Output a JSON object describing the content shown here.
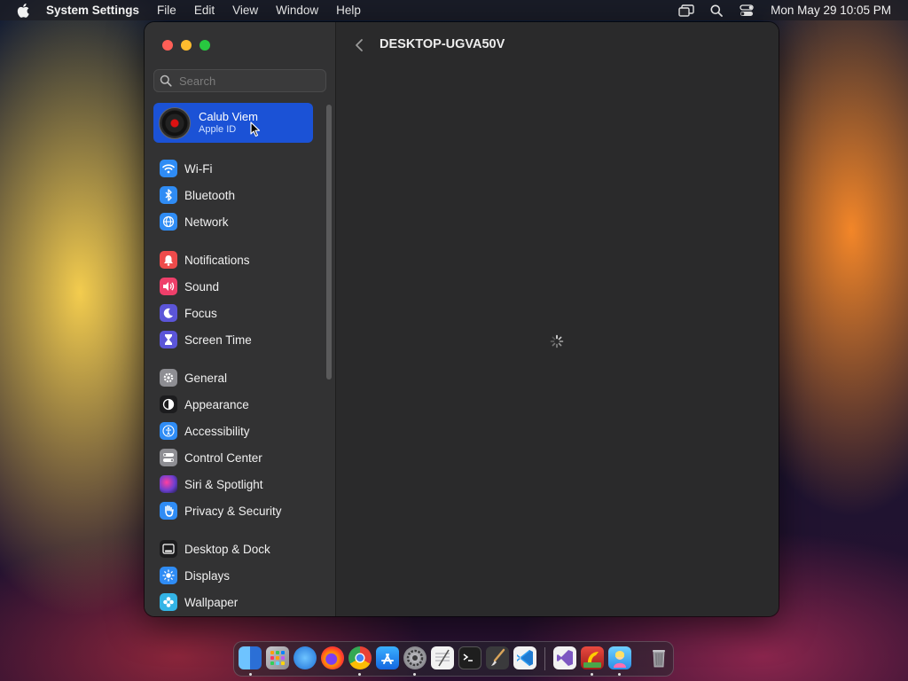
{
  "menubar": {
    "app_name": "System Settings",
    "menus": [
      "File",
      "Edit",
      "View",
      "Window",
      "Help"
    ],
    "clock": "Mon May 29  10:05 PM"
  },
  "sidebar": {
    "search_placeholder": "Search",
    "account": {
      "name": "Calub Viem",
      "subtitle": "Apple ID"
    },
    "items": [
      {
        "label": "Wi-Fi",
        "icon": "wifi-icon",
        "color": "#2f8cf5"
      },
      {
        "label": "Bluetooth",
        "icon": "bluetooth-icon",
        "color": "#2f8cf5"
      },
      {
        "label": "Network",
        "icon": "globe-icon",
        "color": "#2f8cf5"
      },
      {
        "label": "Notifications",
        "icon": "bell-icon",
        "color": "#ee4b4b"
      },
      {
        "label": "Sound",
        "icon": "speaker-icon",
        "color": "#ee3f6a"
      },
      {
        "label": "Focus",
        "icon": "moon-icon",
        "color": "#5b55d8"
      },
      {
        "label": "Screen Time",
        "icon": "hourglass-icon",
        "color": "#5b55d8"
      },
      {
        "label": "General",
        "icon": "gear-icon",
        "color": "#8e8e93"
      },
      {
        "label": "Appearance",
        "icon": "appearance-icon",
        "color": "#1c1c1e"
      },
      {
        "label": "Accessibility",
        "icon": "accessibility-icon",
        "color": "#2f8cf5"
      },
      {
        "label": "Control Center",
        "icon": "control-center-icon",
        "color": "#8e8e93"
      },
      {
        "label": "Siri & Spotlight",
        "icon": "siri-icon",
        "color": "#6b3fd0"
      },
      {
        "label": "Privacy & Security",
        "icon": "hand-icon",
        "color": "#2f8cf5"
      },
      {
        "label": "Desktop & Dock",
        "icon": "dock-icon",
        "color": "#1c1c1e"
      },
      {
        "label": "Displays",
        "icon": "sun-icon",
        "color": "#2f8cf5"
      },
      {
        "label": "Wallpaper",
        "icon": "wallpaper-icon",
        "color": "#33b4e6"
      }
    ]
  },
  "content": {
    "title": "DESKTOP-UGVA50V"
  },
  "dock": {
    "apps": [
      {
        "name": "finder-icon",
        "color": "#3d8fe8"
      },
      {
        "name": "launchpad-icon",
        "color": "#c8c8cc"
      },
      {
        "name": "safari-icon",
        "color": "#2f8cf5"
      },
      {
        "name": "firefox-icon",
        "color": "#ff7a18"
      },
      {
        "name": "chrome-icon",
        "color": "#e94235"
      },
      {
        "name": "app-store-icon",
        "color": "#1d8cf0"
      },
      {
        "name": "system-settings-icon",
        "color": "#8e8e93"
      },
      {
        "name": "textedit-icon",
        "color": "#f2f2f2"
      },
      {
        "name": "terminal-icon",
        "color": "#1e1e1e"
      },
      {
        "name": "paintbrush-icon",
        "color": "#3a3a3c"
      },
      {
        "name": "vscode-icon",
        "color": "#1f7ad1"
      },
      {
        "name": "visual-studio-icon",
        "color": "#7d57c2"
      },
      {
        "name": "parrot-app-icon",
        "color": "#d8312b"
      },
      {
        "name": "character-app-icon",
        "color": "#3da7f2"
      },
      {
        "name": "trash-icon",
        "color": "#8e8e93"
      }
    ]
  }
}
